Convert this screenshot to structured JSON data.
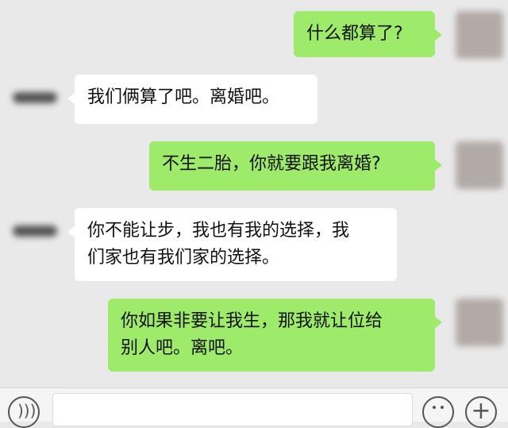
{
  "messages": [
    {
      "side": "me",
      "text": "什么都算了?"
    },
    {
      "side": "other",
      "text": "我们俩算了吧。离婚吧。"
    },
    {
      "side": "me",
      "text": "不生二胎，你就要跟我离婚?"
    },
    {
      "side": "other",
      "lines": [
        "你不能让步，我也有我的选择，我",
        "们家也有我们家的选择。"
      ]
    },
    {
      "side": "me",
      "lines": [
        "你如果非要让我生，那我就让位给",
        "别人吧。离吧。"
      ]
    }
  ],
  "inputbar": {
    "voice_icon": "voice-icon",
    "emoji_icon": "emoji-icon",
    "plus_icon": "plus-icon",
    "plus_glyph": "+"
  }
}
